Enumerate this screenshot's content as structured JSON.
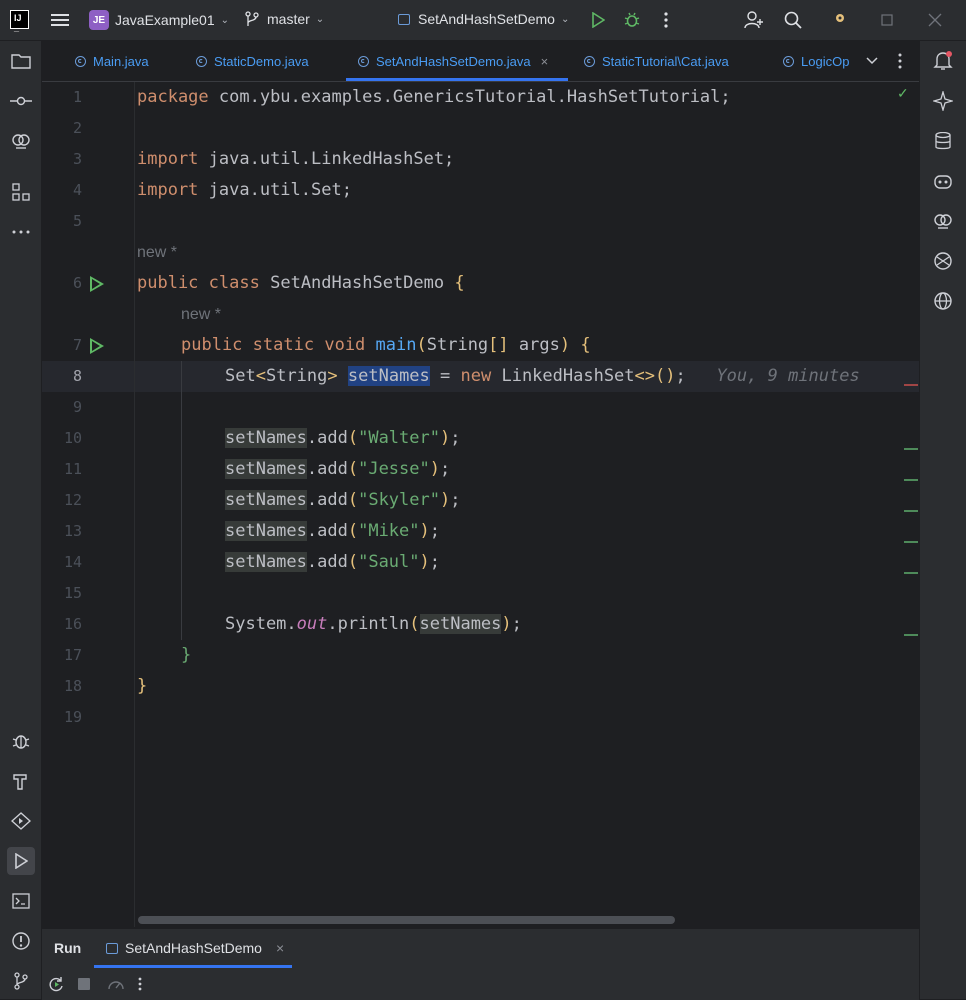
{
  "titlebar": {
    "project_badge": "JE",
    "project_name": "JavaExample01",
    "branch": "master",
    "run_config": "SetAndHashSetDemo"
  },
  "tabs": [
    {
      "label": "Main.java",
      "active": false,
      "closable": false
    },
    {
      "label": "StaticDemo.java",
      "active": false,
      "closable": false
    },
    {
      "label": "SetAndHashSetDemo.java",
      "active": true,
      "closable": true
    },
    {
      "label": "StaticTutorial\\Cat.java",
      "active": false,
      "closable": false
    },
    {
      "label": "LogicOp",
      "active": false,
      "closable": false
    }
  ],
  "editor": {
    "current_line": 8,
    "line_numbers": [
      "1",
      "2",
      "3",
      "4",
      "5",
      "6",
      "7",
      "8",
      "9",
      "10",
      "11",
      "12",
      "13",
      "14",
      "15",
      "16",
      "17",
      "18",
      "19"
    ],
    "hints": {
      "class_hint": "new *",
      "method_hint": "new *",
      "blame": "You, 9 minutes"
    },
    "code": {
      "package_kw": "package",
      "package_name": " com.ybu.examples.GenericsTutorial.HashSetTutorial;",
      "import_kw": "import",
      "import1": " java.util.LinkedHashSet;",
      "import2": " java.util.Set;",
      "public_kw": "public",
      "class_kw": "class",
      "class_name": "SetAndHashSetDemo",
      "static_kw": "static",
      "void_kw": "void",
      "main_fn": "main",
      "main_params": "String",
      "args": " args",
      "set_type": "Set",
      "string_type": "String",
      "var_name": "setNames",
      "new_kw": "new",
      "impl_type": "LinkedHashSet",
      "add_call": ".add",
      "names": [
        "\"Walter\"",
        "\"Jesse\"",
        "\"Skyler\"",
        "\"Mike\"",
        "\"Saul\""
      ],
      "system": "System.",
      "out": "out",
      "println": ".println"
    }
  },
  "run_panel": {
    "title": "Run",
    "config_tab": "SetAndHashSetDemo"
  }
}
